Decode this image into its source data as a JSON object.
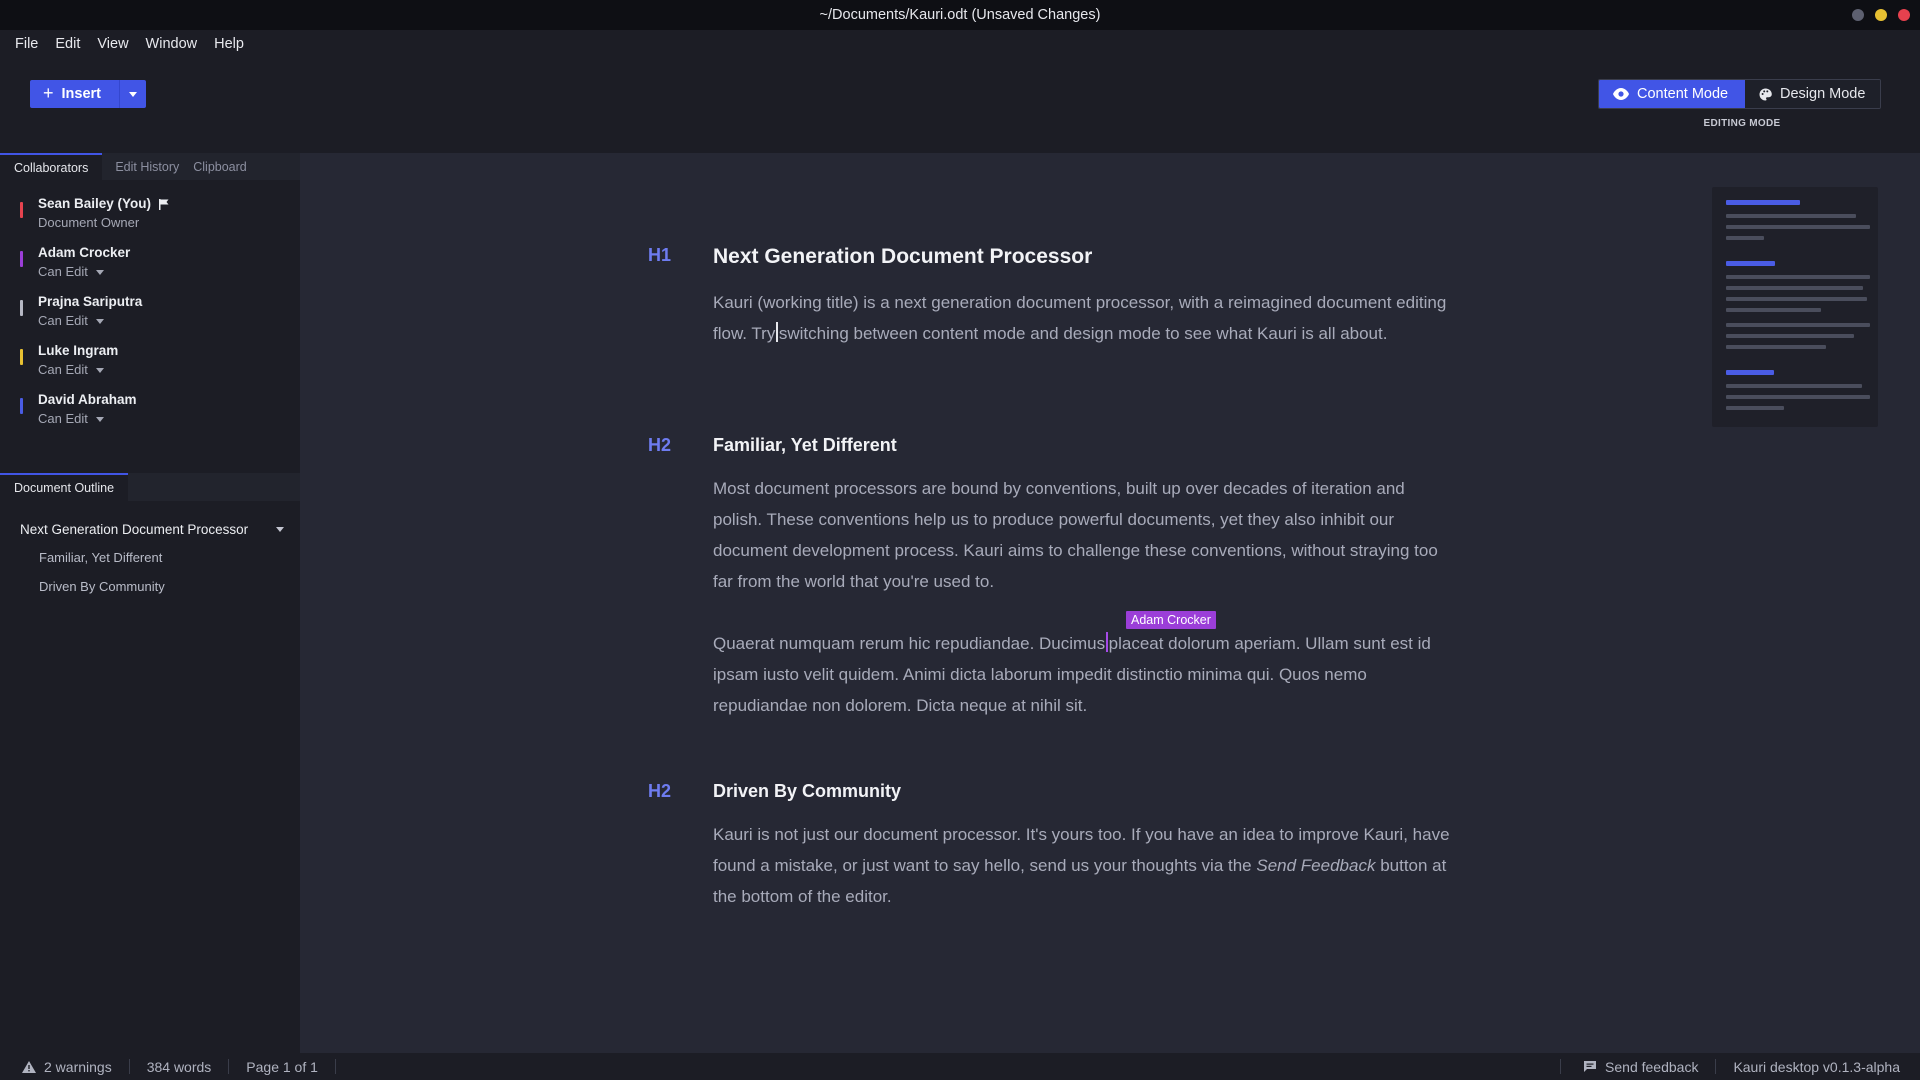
{
  "window": {
    "title": "~/Documents/Kauri.odt (Unsaved Changes)",
    "dots": [
      "#5d6070",
      "#e7c032",
      "#e6414e"
    ]
  },
  "menu": [
    "File",
    "Edit",
    "View",
    "Window",
    "Help"
  ],
  "toolbar": {
    "insert_label": "Insert",
    "content_mode": "Content Mode",
    "design_mode": "Design Mode",
    "mode_caption": "EDITING MODE"
  },
  "sidebar": {
    "tabs": [
      "Collaborators",
      "Edit History",
      "Clipboard"
    ],
    "collaborators": [
      {
        "name": "Sean Bailey (You)",
        "role": "Document Owner",
        "color": "#e5434f"
      },
      {
        "name": "Adam Crocker",
        "role": "Can Edit",
        "color": "#9b3ed8"
      },
      {
        "name": "Prajna Sariputra",
        "role": "Can Edit",
        "color": "#b6b8c4"
      },
      {
        "name": "Luke Ingram",
        "role": "Can Edit",
        "color": "#e7c032"
      },
      {
        "name": "David Abraham",
        "role": "Can Edit",
        "color": "#4a5ce4"
      }
    ],
    "outline_tab": "Document Outline",
    "outline": {
      "h1": "Next Generation Document Processor",
      "h2": [
        "Familiar, Yet Different",
        "Driven By Community"
      ]
    }
  },
  "document": {
    "h1_label": "H1",
    "h2_label": "H2",
    "title": "Next Generation Document Processor",
    "intro_before_cursor": "Kauri (working title) is a next generation document processor, with a reimagined document editing flow. Try",
    "intro_after_cursor": "switching between content mode and design mode to see what Kauri is all about.",
    "section1_title": "Familiar, Yet Different",
    "section1_p1": "Most document processors are bound by conventions, built up over decades of iteration and polish. These conventions help us to produce powerful documents, yet they also inhibit our document development process. Kauri aims to challenge these conventions, without straying too far from the world that you're used to.",
    "section1_p2_before": "Quaerat numquam rerum hic repudiandae. Ducimus",
    "section1_p2_after": "placeat dolorum aperiam. Ullam sunt est id ipsam iusto velit quidem. Animi dicta laborum impedit distinctio minima qui. Quos nemo repudiandae non dolorem. Dicta neque at nihil sit.",
    "collab_tag": "Adam Crocker",
    "section2_title": "Driven By Community",
    "section2_before": "Kauri is not just our document processor. It's yours too. If you have an idea to improve Kauri, have found a mistake, or just want to say hello, send us your thoughts via the ",
    "section2_em": "Send Feedback",
    "section2_after": " button at the bottom of the editor."
  },
  "status": {
    "warnings": "2 warnings",
    "words": "384 words",
    "page": "Page 1 of 1",
    "feedback": "Send feedback",
    "version": "Kauri desktop v0.1.3-alpha"
  },
  "colors": {
    "accent": "#4155e6",
    "background": "#262834",
    "panel": "#1c1d25"
  }
}
